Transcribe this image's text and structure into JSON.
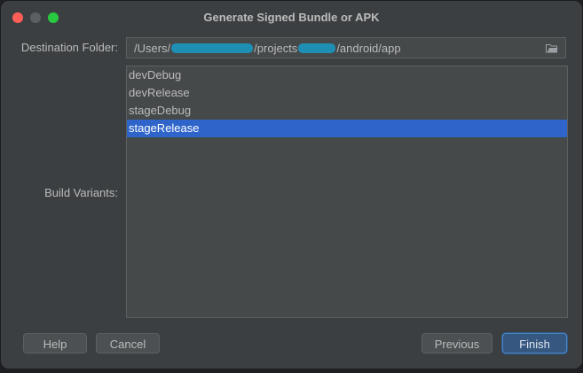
{
  "window": {
    "title": "Generate Signed Bundle or APK"
  },
  "destination": {
    "label": "Destination Folder:",
    "path_part1": "/Users/",
    "path_part2": "/projects",
    "path_part3": "/android/app"
  },
  "build_variants": {
    "label": "Build Variants:",
    "items": [
      {
        "label": "devDebug",
        "selected": false
      },
      {
        "label": "devRelease",
        "selected": false
      },
      {
        "label": "stageDebug",
        "selected": false
      },
      {
        "label": "stageRelease",
        "selected": true
      }
    ]
  },
  "buttons": {
    "help": "Help",
    "cancel": "Cancel",
    "previous": "Previous",
    "finish": "Finish"
  },
  "colors": {
    "selection": "#2f65ca",
    "redaction": "#1e8fb3",
    "close": "#ff5f57",
    "maximize": "#28c840"
  },
  "icons": {
    "destination_browse": "folder-icon"
  }
}
